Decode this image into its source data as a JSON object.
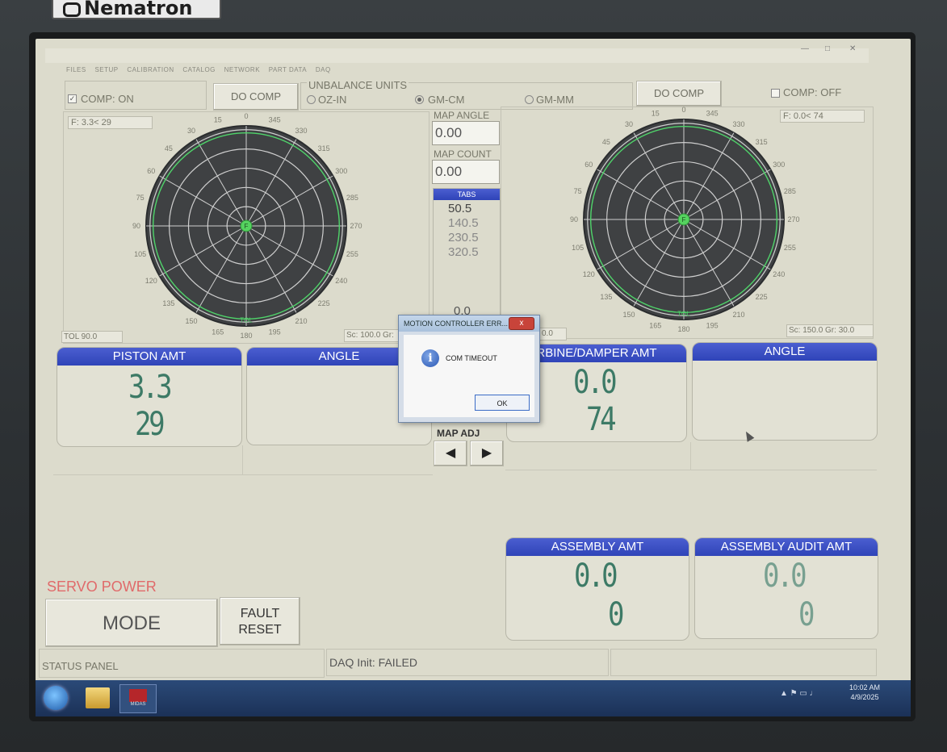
{
  "device": {
    "brand": "Nematron"
  },
  "menu": [
    "FILES",
    "SETUP",
    "CALIBRATION",
    "CATALOG",
    "NETWORK",
    "PART DATA",
    "DAQ"
  ],
  "left_comp": {
    "checkbox_label": "COMP:  ON",
    "do_comp": "DO COMP"
  },
  "units": {
    "title": "UNBALANCE UNITS",
    "options": [
      "OZ-IN",
      "GM-CM",
      "GM-MM"
    ],
    "selected": "GM-CM"
  },
  "right_comp": {
    "do_comp": "DO COMP",
    "checkbox_label": "COMP: OFF"
  },
  "left_polar": {
    "readout": "F:   3.3< 29",
    "tol": "TOL  90.0",
    "scale": "Sc: 100.0 Gr:",
    "center_label": "F",
    "tol_marker": "TOL",
    "angles": [
      "0",
      "345",
      "330",
      "315",
      "300",
      "285",
      "270",
      "255",
      "240",
      "225",
      "210",
      "195",
      "180",
      "165",
      "150",
      "135",
      "120",
      "105",
      "90",
      "75",
      "60",
      "45",
      "30",
      "15"
    ]
  },
  "right_polar": {
    "readout": "F:   0.0< 74",
    "scale": "Sc: 150.0  Gr:  30.0",
    "center_label": "F",
    "tol_marker": "TOL",
    "angles": [
      "0",
      "345",
      "330",
      "315",
      "300",
      "285",
      "270",
      "255",
      "240",
      "225",
      "210",
      "195",
      "180",
      "165",
      "150",
      "135",
      "120",
      "105",
      "90",
      "75",
      "60",
      "45",
      "30",
      "15"
    ]
  },
  "map": {
    "angle_label": "MAP ANGLE",
    "angle_value": "0.00",
    "count_label": "MAP COUNT",
    "count_value": "0.00",
    "tabs_header": "TABS",
    "tabs": [
      "50.5",
      "140.5",
      "230.5",
      "320.5"
    ],
    "bottom_value": "0.0",
    "adj_label": "MAP ADJ",
    "cut_left": "0.0"
  },
  "panels": {
    "piston": {
      "title": "PISTON AMT",
      "amount": "3.3",
      "angle": "29"
    },
    "angle_left": {
      "title": "ANGLE"
    },
    "turbine": {
      "title": "RBINE/DAMPER AMT",
      "amount": "0.0",
      "angle": "74"
    },
    "angle_right": {
      "title": "ANGLE"
    },
    "assembly": {
      "title": "ASSEMBLY AMT",
      "amount": "0.0",
      "angle": "0"
    },
    "audit": {
      "title": "ASSEMBLY AUDIT AMT",
      "amount": "0.0",
      "angle": "0"
    }
  },
  "servo": {
    "label": "SERVO POWER",
    "mode": "MODE",
    "fault_line1": "FAULT",
    "fault_line2": "RESET"
  },
  "status": {
    "panel_label": "STATUS PANEL",
    "daq": "DAQ Init: FAILED"
  },
  "dialog": {
    "title": "MOTION CONTROLLER ERR...",
    "close": "x",
    "message": "COM TIMEOUT",
    "ok": "OK"
  },
  "taskbar": {
    "time": "10:02 AM",
    "date": "4/9/2025",
    "app_label": "MIDAS"
  },
  "colors": {
    "accent_blue": "#3548c0",
    "digit_green": "#3d7a66",
    "servo_red": "#e06a6a",
    "polar_dark": "#3f4143",
    "polar_ring": "#c9c9c9",
    "tol_green": "#4fd46a"
  }
}
